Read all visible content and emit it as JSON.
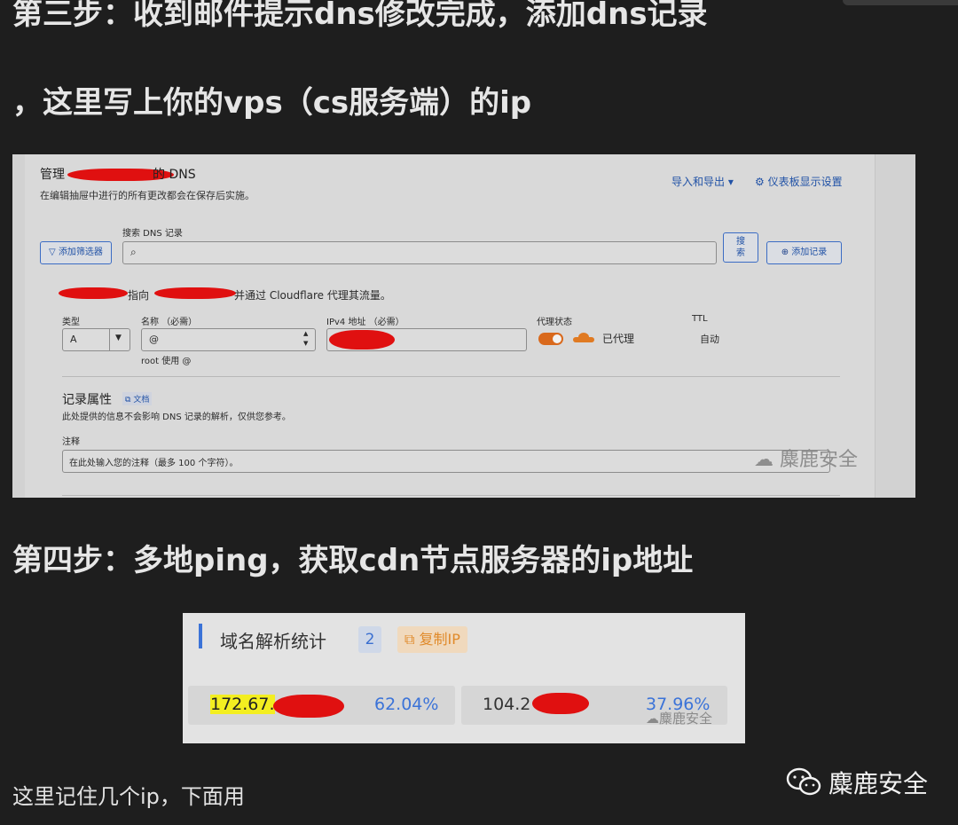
{
  "headings": {
    "step3_line1": "第三步：收到邮件提示dns修改完成，添加dns记录",
    "step3_line2": "，这里写上你的vps（cs服务端）的ip",
    "step4": "第四步：多地ping，获取cdn节点服务器的ip地址"
  },
  "dns_panel": {
    "title_prefix": "管理",
    "title_suffix": "的 DNS",
    "subtitle": "在编辑抽屉中进行的所有更改都会在保存后实施。",
    "import_export": "导入和导出",
    "dashboard_settings": "仪表板显示设置",
    "add_filter": "添加筛选器",
    "search_label": "搜索 DNS 记录",
    "search_button_l1": "搜",
    "search_button_l2": "索",
    "add_record": "添加记录",
    "points_to": "指向",
    "proxy_note": "并通过 Cloudflare 代理其流量。",
    "labels": {
      "type": "类型",
      "name": "名称 （必需）",
      "ipv4": "IPv4 地址 （必需）",
      "proxy": "代理状态",
      "ttl": "TTL"
    },
    "values": {
      "type": "A",
      "name": "@",
      "name_hint": "root 使用 @",
      "proxy_status": "已代理",
      "ttl": "自动"
    },
    "record_attrs": "记录属性",
    "docs": "文档",
    "record_attrs_note": "此处提供的信息不会影响 DNS 记录的解析，仅供您参考。",
    "comment_label": "注释",
    "comment_placeholder": "在此处输入您的注释（最多 100 个字符）。",
    "watermark": "麋鹿安全"
  },
  "stats_panel": {
    "title": "域名解析统计",
    "count": "2",
    "copy_ip": "复制IP",
    "ip1": "172.67.",
    "ip1_pct": "62.04%",
    "ip2": "104.2",
    "ip2_pct": "37.96%",
    "watermark": "麋鹿安全"
  },
  "footer": {
    "note": "这里记住几个ip，下面用",
    "brand": "麋鹿安全"
  }
}
